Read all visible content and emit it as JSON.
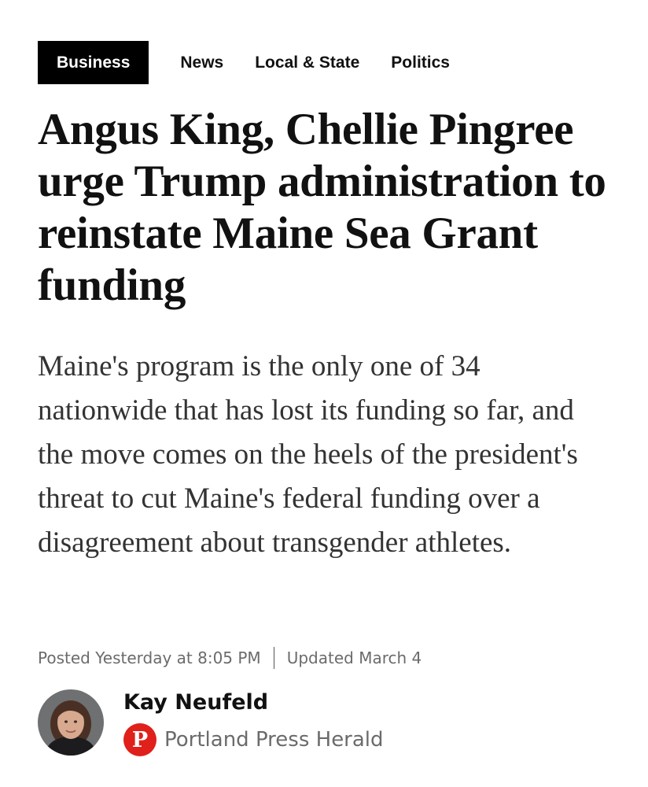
{
  "nav": {
    "tabs": [
      {
        "label": "Business",
        "active": true
      },
      {
        "label": "News",
        "active": false
      },
      {
        "label": "Local & State",
        "active": false
      },
      {
        "label": "Politics",
        "active": false
      }
    ]
  },
  "article": {
    "headline": "Angus King, Chellie Pingree urge Trump administration to reinstate Maine Sea Grant funding",
    "dek": "Maine's program is the only one of 34 nationwide that has lost its funding so far, and the move comes on the heels of the president's threat to cut Maine's federal funding over a disagreement about transgender athletes.",
    "posted": "Posted Yesterday at 8:05 PM",
    "updated": "Updated March 4"
  },
  "author": {
    "name": "Kay Neufeld",
    "publication": "Portland Press Herald",
    "publication_logo_letter": "P"
  },
  "colors": {
    "accent": "#e0201b",
    "active_tab_bg": "#000000",
    "meta_text": "#6b6b6b"
  },
  "icons": {
    "avatar": "author-photo",
    "publication_logo": "portland-press-herald-logo"
  }
}
